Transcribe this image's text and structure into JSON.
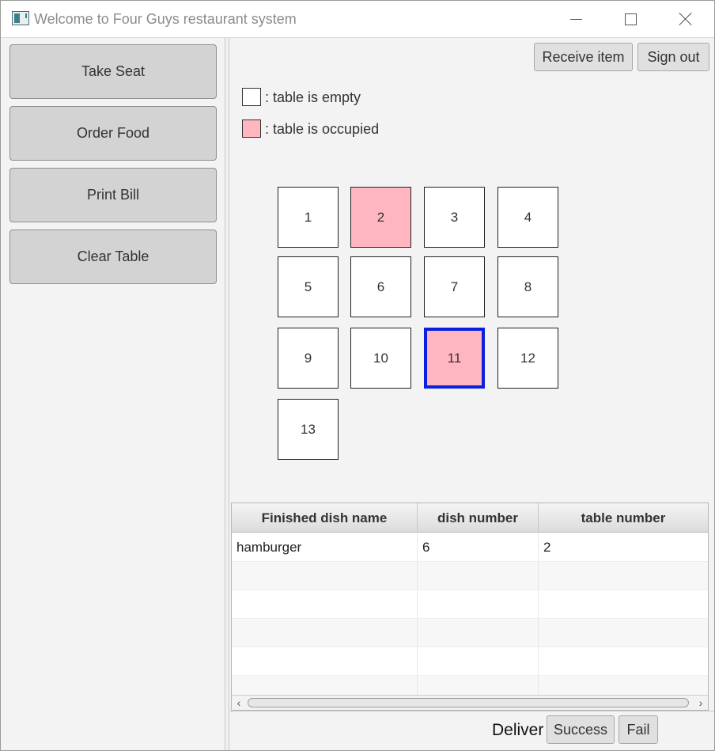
{
  "window": {
    "title": "Welcome to Four Guys restaurant system",
    "controls": {
      "minimize": "minimize-icon",
      "maximize": "maximize-icon",
      "close": "close-icon"
    }
  },
  "sidebar": {
    "buttons": [
      {
        "label": "Take Seat"
      },
      {
        "label": "Order Food"
      },
      {
        "label": "Print Bill"
      },
      {
        "label": "Clear Table"
      }
    ]
  },
  "toolbar": {
    "receive_label": "Receive item",
    "signout_label": "Sign out"
  },
  "legend": {
    "empty_label": ": table is empty",
    "occupied_label": ": table is occupied",
    "empty_color": "#ffffff",
    "occupied_color": "#ffb6c1"
  },
  "tables": [
    {
      "number": "1",
      "occupied": false,
      "selected": false
    },
    {
      "number": "2",
      "occupied": true,
      "selected": false
    },
    {
      "number": "3",
      "occupied": false,
      "selected": false
    },
    {
      "number": "4",
      "occupied": false,
      "selected": false
    },
    {
      "number": "5",
      "occupied": false,
      "selected": false
    },
    {
      "number": "6",
      "occupied": false,
      "selected": false
    },
    {
      "number": "7",
      "occupied": false,
      "selected": false
    },
    {
      "number": "8",
      "occupied": false,
      "selected": false
    },
    {
      "number": "9",
      "occupied": false,
      "selected": false
    },
    {
      "number": "10",
      "occupied": false,
      "selected": false
    },
    {
      "number": "11",
      "occupied": true,
      "selected": true
    },
    {
      "number": "12",
      "occupied": false,
      "selected": false
    },
    {
      "number": "13",
      "occupied": false,
      "selected": false
    }
  ],
  "selection_color": "#0a1fe0",
  "finished_dishes": {
    "columns": [
      "Finished dish name",
      "dish number",
      "table number"
    ],
    "rows": [
      [
        "hamburger",
        "6",
        "2"
      ]
    ]
  },
  "deliver": {
    "label": "Deliver",
    "success_label": "Success",
    "fail_label": "Fail"
  }
}
